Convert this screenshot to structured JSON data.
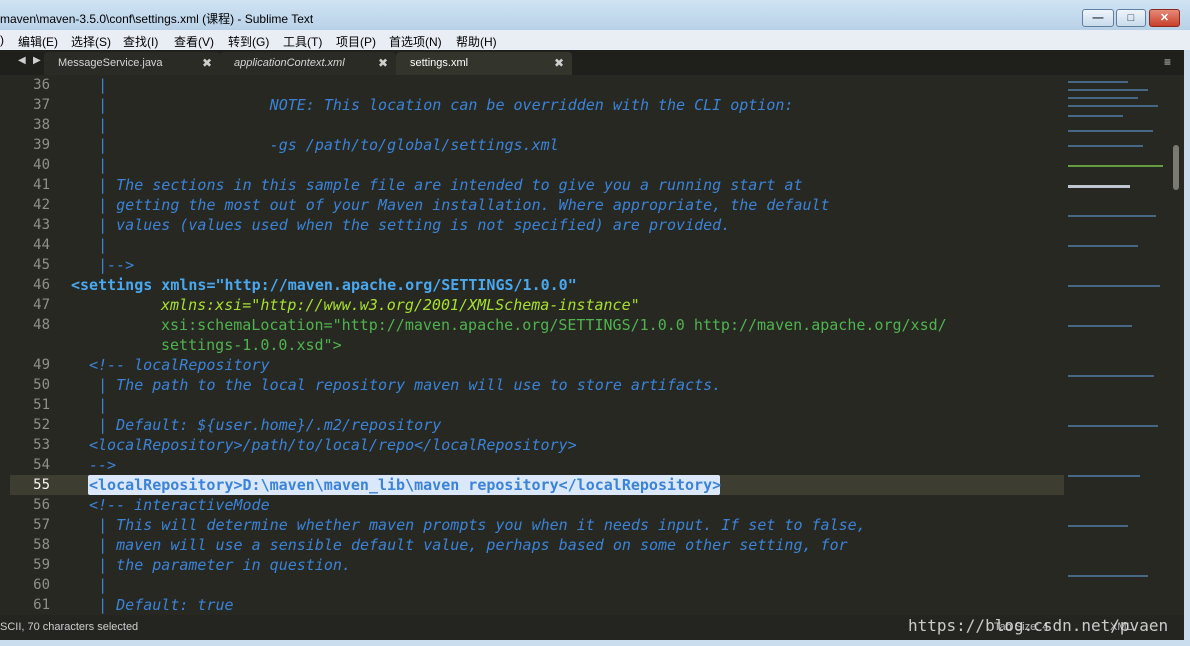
{
  "window": {
    "title": "maven\\maven-3.5.0\\conf\\settings.xml (课程) - Sublime Text",
    "controls": {
      "minimize": "—",
      "maximize": "□",
      "close": "✕"
    }
  },
  "menu": [
    "编辑(E)",
    "选择(S)",
    "查找(I)",
    "查看(V)",
    "转到(G)",
    "工具(T)",
    "项目(P)",
    "首选项(N)",
    "帮助(H)"
  ],
  "menu_partial": ")",
  "tabs": [
    {
      "label": "MessageService.java",
      "close": "✖"
    },
    {
      "label": "applicationContext.xml",
      "close": "✖"
    },
    {
      "label": "settings.xml",
      "close": "✖",
      "active": true
    }
  ],
  "nav": {
    "back": "◀",
    "forward": "▶",
    "menu": "≡"
  },
  "editor": {
    "line_numbers": [
      "36",
      "37",
      "38",
      "39",
      "40",
      "41",
      "42",
      "43",
      "44",
      "45",
      "46",
      "47",
      "48",
      "",
      "49",
      "50",
      "51",
      "52",
      "53",
      "54",
      "55",
      "56",
      "57",
      "58",
      "59",
      "60",
      "61"
    ],
    "lines": [
      "   |",
      "   |                  NOTE: This location can be overridden with the CLI option:",
      "   |",
      "   |                  -gs /path/to/global/settings.xml",
      "   |",
      "   | The sections in this sample file are intended to give you a running start at",
      "   | getting the most out of your Maven installation. Where appropriate, the default",
      "   | values (values used when the setting is not specified) are provided.",
      "   |",
      "   |-->",
      "settings xmlns=\"http://maven.apache.org/SETTINGS/1.0.0\"",
      "xmlns:xsi=\"http://www.w3.org/2001/XMLSchema-instance\"",
      "xsi:schemaLocation=\"http://maven.apache.org/SETTINGS/1.0.0 http://maven.apache.org/xsd/",
      "settings-1.0.0.xsd\">",
      "<!-- localRepository",
      "   | The path to the local repository maven will use to store artifacts.",
      "   |",
      "   | Default: ${user.home}/.m2/repository",
      "<localRepository>/path/to/local/repo</localRepository>",
      "-->",
      "<localRepository>D:\\maven\\maven_lib\\maven repository</localRepository>",
      "<!-- interactiveMode",
      "   | This will determine whether maven prompts you when it needs input. If set to false,",
      "   | maven will use a sensible default value, perhaps based on some other setting, for",
      "   | the parameter in question.",
      "   |",
      "   | Default: true"
    ],
    "current_line": "55",
    "selected_text": "D:\\maven\\maven_lib\\maven repository"
  },
  "status": {
    "left": "SCII, 70 characters selected",
    "tab_size": "Tab Size: 4",
    "syntax": "XML"
  },
  "watermark": "https://blog.csdn.net/pvaen",
  "colors": {
    "background": "#272822",
    "comment": "#3b83d8",
    "tag": "#4aa8f0",
    "attribute": "#a6e22e",
    "string": "#4fb34f",
    "selection": "#dbe8fb"
  }
}
